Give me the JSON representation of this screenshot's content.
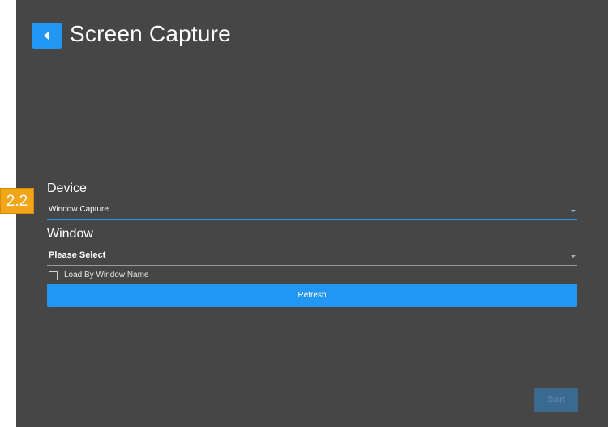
{
  "header": {
    "back_icon": "chevron-left-icon",
    "title": "Screen Capture"
  },
  "annotation": {
    "step_label": "2.2",
    "color": "#f2a516"
  },
  "device": {
    "label": "Device",
    "selected_value": "Window Capture"
  },
  "window": {
    "label": "Window",
    "selected_value": "Please Select"
  },
  "load_by_name": {
    "label": "Load By Window Name",
    "checked": false
  },
  "actions": {
    "refresh_label": "Refresh",
    "start_label": "Start",
    "start_enabled": false
  },
  "colors": {
    "accent": "#2196f3",
    "panel_background": "#464646"
  }
}
